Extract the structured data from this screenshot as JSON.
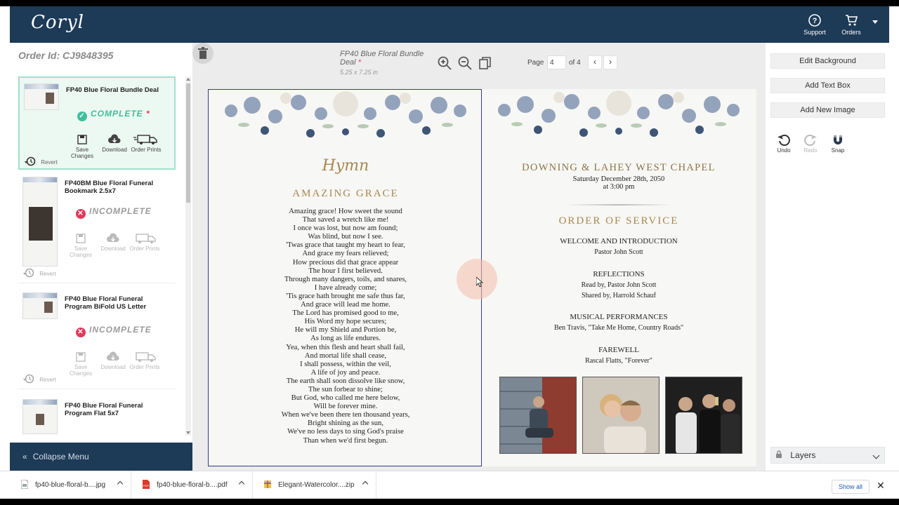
{
  "app": {
    "logo": "Coryl"
  },
  "nav": {
    "support": "Support",
    "orders": "Orders"
  },
  "order": {
    "id_label": "Order Id: CJ9848395"
  },
  "documents": [
    {
      "title": "FP40 Blue Floral Bundle Deal",
      "status": "COMPLETE",
      "status_star": "*",
      "save": "Save Changes",
      "download": "Download",
      "order_prints": "Order Prints",
      "revert": "Revert"
    },
    {
      "title": "FP40BM Blue Floral Funeral Bookmark 2.5x7",
      "status": "INCOMPLETE",
      "save": "Save Changes",
      "download": "Download",
      "order_prints": "Order Prints",
      "revert": "Revert"
    },
    {
      "title": "FP40 Blue Floral Funeral Program BiFold US Letter",
      "status": "INCOMPLETE",
      "save": "Save Changes",
      "download": "Download",
      "order_prints": "Order Prints",
      "revert": "Revert"
    },
    {
      "title": "FP40 Blue Floral Funeral Program Flat 5x7"
    }
  ],
  "collapse_menu": "Collapse Menu",
  "editor": {
    "doc_name": "FP40 Blue Floral Bundle Deal",
    "doc_name_star": "*",
    "doc_size": "5.25 x 7.25 in",
    "page_label": "Page",
    "page_value": "4",
    "page_of": "of 4"
  },
  "left_page": {
    "script_title": "Hymn",
    "title": "AMAZING GRACE",
    "lyrics": [
      "Amazing grace! How sweet the sound",
      "That saved a wretch like me!",
      "I once was lost, but now am found;",
      "Was blind, but now I see.",
      "'Twas grace that taught my heart to fear,",
      "And grace my fears relieved;",
      "How precious did that grace appear",
      "The hour I first believed.",
      "Through many dangers, toils, and snares,",
      "I have already come;",
      "'Tis grace hath brought me safe thus far,",
      "And grace will lead me home.",
      "The Lord has promised good to me,",
      "His Word my hope secures;",
      "He will my Shield and Portion be,",
      "As long as life endures.",
      "Yea, when this flesh and heart shall fail,",
      "And mortal life shall cease,",
      "I shall possess, within the veil,",
      "A life of joy and peace.",
      "The earth shall soon dissolve like snow,",
      "The sun forbear to shine;",
      "But God, who called me here below,",
      "Will be forever mine.",
      "When we've been there ten thousand years,",
      "Bright shining as the sun,",
      "We've no less days to sing God's praise",
      "Than when we'd first begun."
    ]
  },
  "right_page": {
    "chapel": "DOWNING & LAHEY WEST CHAPEL",
    "date": "Saturday December 28th, 2050",
    "time": "at 3:00 pm",
    "heading": "ORDER OF SERVICE",
    "sections": [
      {
        "title": "WELCOME AND INTRODUCTION",
        "lines": [
          "Pastor John Scott"
        ]
      },
      {
        "title": "REFLECTIONS",
        "lines": [
          "Read by, Pastor John Scott",
          "Shared by, Harrold Schauf"
        ]
      },
      {
        "title": "MUSICAL PERFORMANCES",
        "lines": [
          "Ben Travis, \"Take Me Home, Country Roads\""
        ]
      },
      {
        "title": "FAREWELL",
        "lines": [
          "Rascal Flatts, \"Forever\""
        ]
      }
    ]
  },
  "right_panel": {
    "edit_background": "Edit Background",
    "add_text_box": "Add Text Box",
    "add_new_image": "Add New Image",
    "undo": "Undo",
    "redo": "Redo",
    "snap": "Snap",
    "layers": "Layers"
  },
  "downloads": {
    "items": [
      "fp40-blue-floral-b....jpg",
      "fp40-blue-floral-b....pdf",
      "Elegant-Watercolor....zip"
    ],
    "show_all": "Show all"
  },
  "colors": {
    "navbar": "#1d3a57",
    "complete": "#3cbf9b",
    "incomplete": "#e23a5b",
    "gold": "#a8874f"
  }
}
